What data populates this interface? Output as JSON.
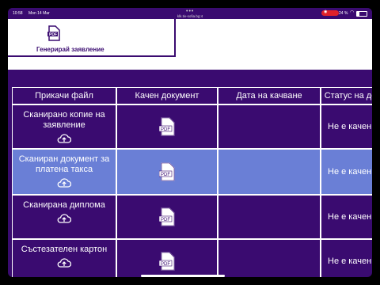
{
  "status_bar": {
    "time": "10:58",
    "date": "Mon 14 Mar",
    "url": "klk.tiv-sofia.bg:4",
    "battery": "24 %",
    "battery_level": 0.24
  },
  "generate_card": {
    "label": "Генерирай заявление",
    "icon": "pdf-icon"
  },
  "table": {
    "headers": [
      "Прикачи файл",
      "Качен документ",
      "Дата на качване",
      "Статус на до"
    ],
    "rows": [
      {
        "file": "Сканирано копие на заявление",
        "status": "Не е качен д",
        "highlighted": false
      },
      {
        "file": "Сканиран документ за платена такса",
        "status": "Не е качен д",
        "highlighted": true
      },
      {
        "file": "Сканирана диплома",
        "status": "Не е качен д",
        "highlighted": false
      },
      {
        "file": "Състезателен картон",
        "status": "Не е качен д",
        "highlighted": false
      }
    ]
  },
  "colors": {
    "primary": "#3a0b70",
    "highlight": "#6a7fd6",
    "record": "#e0222a"
  }
}
